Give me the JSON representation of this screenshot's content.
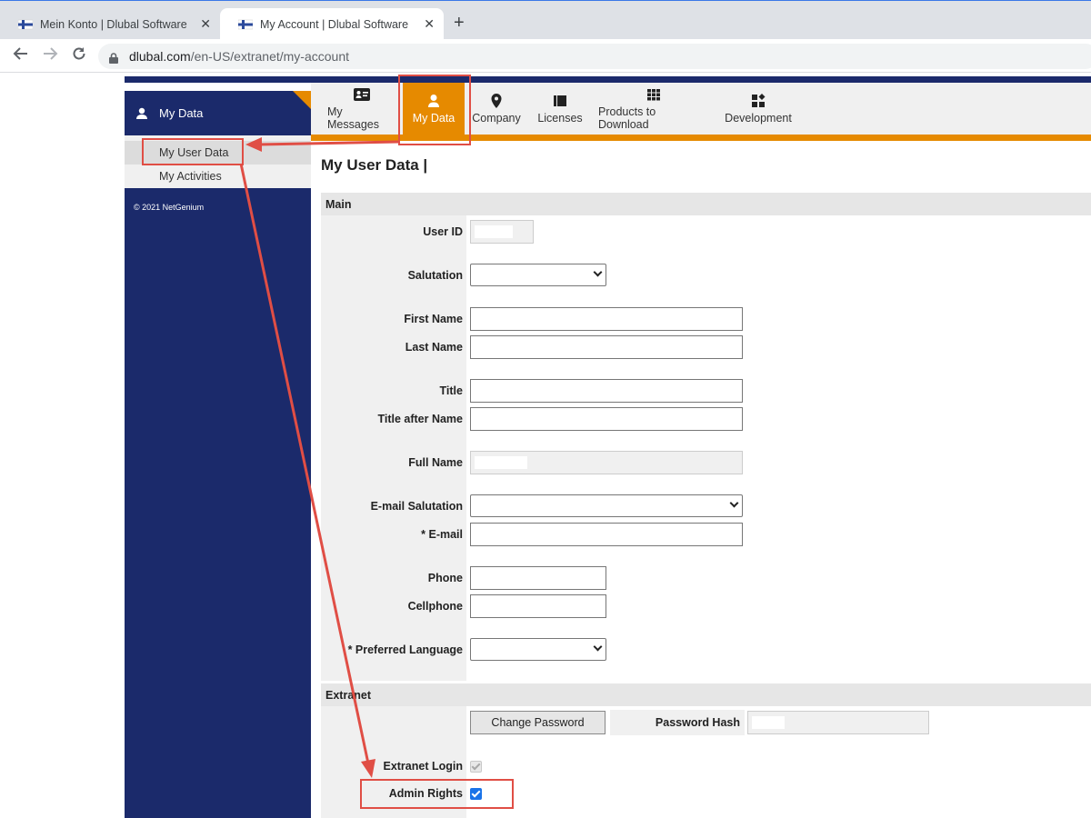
{
  "browser": {
    "tabs": [
      {
        "title": "Mein Konto | Dlubal Software",
        "active": false
      },
      {
        "title": "My Account | Dlubal Software",
        "active": true
      }
    ],
    "new_tab": "+",
    "address": {
      "domain": "dlubal.com",
      "path": "/en-US/extranet/my-account"
    }
  },
  "sidebar": {
    "header": "My Data",
    "items": [
      {
        "label": "My User Data",
        "selected": true
      },
      {
        "label": "My Activities",
        "selected": false
      }
    ],
    "copyright": "© 2021 NetGenium"
  },
  "navbar": {
    "tabs": [
      {
        "label": "My Messages",
        "icon": "id-card-icon",
        "active": false
      },
      {
        "label": "My Data",
        "icon": "person-icon",
        "active": true
      },
      {
        "label": "Company",
        "icon": "map-pin-icon",
        "active": false
      },
      {
        "label": "Licenses",
        "icon": "license-icon",
        "active": false
      },
      {
        "label": "Products to Download",
        "icon": "grid-icon",
        "active": false
      },
      {
        "label": "Development",
        "icon": "apps-icon",
        "active": false
      }
    ]
  },
  "page": {
    "title": "My User Data |",
    "sections": {
      "main": "Main",
      "extranet": "Extranet"
    }
  },
  "form": {
    "user_id": {
      "label": "User ID",
      "value": ""
    },
    "salutation": {
      "label": "Salutation",
      "value": ""
    },
    "first_name": {
      "label": "First Name",
      "value": ""
    },
    "last_name": {
      "label": "Last Name",
      "value": ""
    },
    "title": {
      "label": "Title",
      "value": ""
    },
    "title_after_name": {
      "label": "Title after Name",
      "value": ""
    },
    "full_name": {
      "label": "Full Name",
      "value": ""
    },
    "email_salutation": {
      "label": "E-mail Salutation",
      "value": ""
    },
    "email": {
      "label": "* E-mail",
      "value": ""
    },
    "phone": {
      "label": "Phone",
      "value": ""
    },
    "cellphone": {
      "label": "Cellphone",
      "value": ""
    },
    "preferred_language": {
      "label": "* Preferred Language",
      "value": ""
    },
    "change_password": "Change Password",
    "password_hash": {
      "label": "Password Hash",
      "value": ""
    },
    "extranet_login": {
      "label": "Extranet Login",
      "checked": true,
      "disabled": true
    },
    "admin_rights": {
      "label": "Admin Rights",
      "checked": true
    }
  },
  "colors": {
    "navy": "#1b2a6b",
    "orange": "#e68a00",
    "annotation": "#e04e45",
    "checkbox": "#1a73e8"
  }
}
